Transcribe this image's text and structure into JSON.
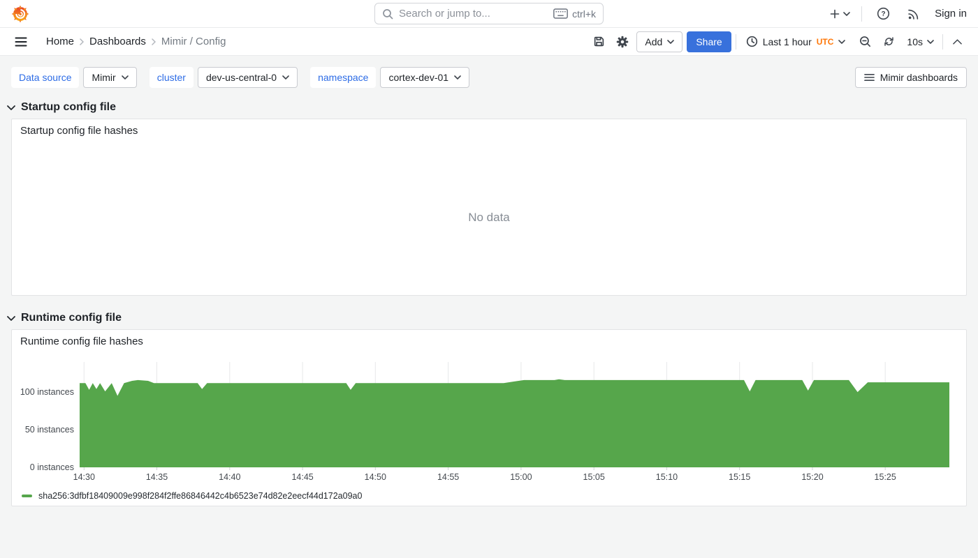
{
  "topnav": {
    "search": {
      "placeholder": "Search or jump to...",
      "shortcut": "ctrl+k"
    },
    "signin_label": "Sign in"
  },
  "toolbar": {
    "breadcrumbs": [
      "Home",
      "Dashboards",
      "Mimir / Config"
    ],
    "add_label": "Add",
    "share_label": "Share",
    "time_range_label": "Last 1 hour",
    "timezone_label": "UTC",
    "refresh_interval": "10s"
  },
  "variables": [
    {
      "label": "Data source",
      "value": "Mimir"
    },
    {
      "label": "cluster",
      "value": "dev-us-central-0"
    },
    {
      "label": "namespace",
      "value": "cortex-dev-01"
    }
  ],
  "dashboards_button_label": "Mimir dashboards",
  "sections": [
    {
      "title": "Startup config file",
      "panel": {
        "title": "Startup config file hashes",
        "status": "No data"
      }
    },
    {
      "title": "Runtime config file",
      "panel": {
        "title": "Runtime config file hashes"
      }
    }
  ],
  "legend": {
    "label": "sha256:3dfbf18409009e998f284f2ffe86846442c4b6523e74d82e2eecf44d172a09a0",
    "color": "#56A64B"
  },
  "colors": {
    "accent_blue": "#3871DC",
    "link_blue": "#2D6CE6",
    "utc_orange": "#FF780A",
    "series_green": "#56A64B"
  },
  "icons": [
    "grafana-logo",
    "search-icon",
    "keyboard-icon",
    "plus-icon",
    "caret-down-icon",
    "help-icon",
    "rss-icon",
    "menu-icon",
    "chevron-right-icon",
    "save-icon",
    "gear-icon",
    "clock-icon",
    "zoom-out-icon",
    "refresh-icon",
    "chevron-up-icon",
    "list-icon",
    "section-chevron-icon",
    "legend-swatch"
  ],
  "chart_data": {
    "type": "area",
    "title": "Runtime config file hashes",
    "xlabel": "",
    "ylabel": "instances",
    "ylim": [
      0,
      140
    ],
    "x_start_min": -0.3,
    "x_end_min": 59.4,
    "grid": "vertical",
    "legend_position": "bottom",
    "x_ticks": [
      {
        "t": 0,
        "label": "14:30"
      },
      {
        "t": 5,
        "label": "14:35"
      },
      {
        "t": 10,
        "label": "14:40"
      },
      {
        "t": 15,
        "label": "14:45"
      },
      {
        "t": 20,
        "label": "14:50"
      },
      {
        "t": 25,
        "label": "14:55"
      },
      {
        "t": 30,
        "label": "15:00"
      },
      {
        "t": 35,
        "label": "15:05"
      },
      {
        "t": 40,
        "label": "15:10"
      },
      {
        "t": 45,
        "label": "15:15"
      },
      {
        "t": 50,
        "label": "15:20"
      },
      {
        "t": 55,
        "label": "15:25"
      }
    ],
    "y_ticks": [
      {
        "v": 0,
        "label": "0 instances"
      },
      {
        "v": 50,
        "label": "50 instances"
      },
      {
        "v": 100,
        "label": "100 instances"
      }
    ],
    "series": [
      {
        "name": "sha256:3dfbf18409009e998f284f2ffe86846442c4b6523e74d82e2eecf44d172a09a0",
        "color": "#56A64B",
        "points_min_value": [
          [
            -0.3,
            112
          ],
          [
            0.1,
            112
          ],
          [
            0.35,
            103
          ],
          [
            0.6,
            112
          ],
          [
            0.85,
            104
          ],
          [
            1.1,
            112
          ],
          [
            1.45,
            101
          ],
          [
            1.9,
            112
          ],
          [
            2.3,
            95
          ],
          [
            2.75,
            112
          ],
          [
            3.3,
            115
          ],
          [
            3.7,
            116
          ],
          [
            4.4,
            115
          ],
          [
            4.8,
            112
          ],
          [
            7.8,
            112
          ],
          [
            8.1,
            104
          ],
          [
            8.45,
            112
          ],
          [
            18.0,
            112
          ],
          [
            18.3,
            103
          ],
          [
            18.65,
            112
          ],
          [
            28.8,
            112
          ],
          [
            29.5,
            114
          ],
          [
            30.2,
            116
          ],
          [
            32.3,
            116
          ],
          [
            32.6,
            117
          ],
          [
            33.0,
            116
          ],
          [
            45.3,
            116
          ],
          [
            45.7,
            101
          ],
          [
            46.1,
            116
          ],
          [
            49.3,
            116
          ],
          [
            49.7,
            102
          ],
          [
            50.1,
            116
          ],
          [
            52.5,
            116
          ],
          [
            53.1,
            100
          ],
          [
            53.8,
            113
          ],
          [
            59.4,
            113
          ]
        ]
      }
    ]
  }
}
